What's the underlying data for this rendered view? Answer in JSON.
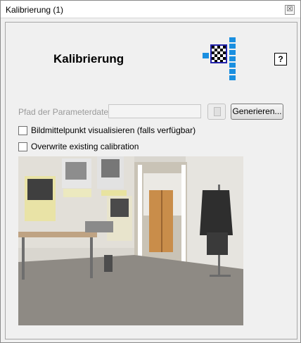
{
  "window": {
    "title": "Kalibrierung (1)",
    "close_glyph": "☒"
  },
  "header": {
    "heading": "Kalibrierung",
    "help_label": "?"
  },
  "logo": {
    "icon": "checkered-grid-logo-icon",
    "colors": [
      "#1a8fe0",
      "#2222aa",
      "#ffffff",
      "#000000"
    ]
  },
  "parameter_file": {
    "label": "Pfad der Parameterdatei:",
    "value": "",
    "placeholder": "",
    "browse_icon": "file-browse-icon"
  },
  "buttons": {
    "generate": "Generieren..."
  },
  "options": [
    {
      "label": "Bildmittelpunkt visualisieren (falls verfügbar)",
      "checked": false
    },
    {
      "label": "Overwrite existing calibration",
      "checked": false
    }
  ],
  "camera": {
    "image": "camera-preview-image"
  }
}
